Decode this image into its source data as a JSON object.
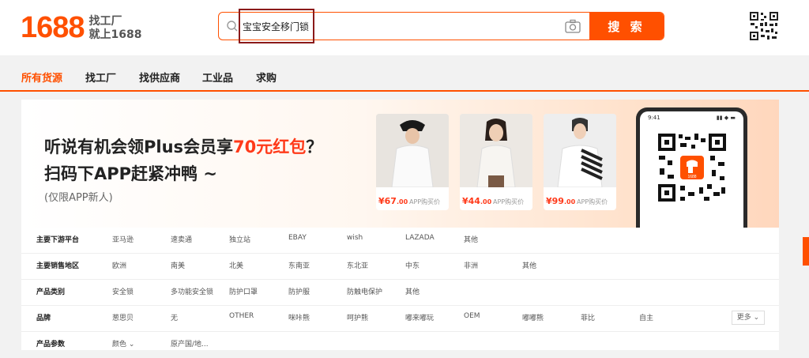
{
  "logo": {
    "number": "1688",
    "slogan_line1": "找工厂",
    "slogan_line2": "就上1688"
  },
  "search": {
    "query": "宝宝安全移门锁",
    "button_label": "搜 索"
  },
  "icons": {
    "search": "search-icon",
    "camera": "camera-icon",
    "qr": "qr-code-icon"
  },
  "colors": {
    "brand": "#ff5000",
    "price": "#ff3a1a"
  },
  "nav": {
    "items": [
      {
        "label": "所有货源",
        "active": true
      },
      {
        "label": "找工厂",
        "active": false
      },
      {
        "label": "找供应商",
        "active": false
      },
      {
        "label": "工业品",
        "active": false
      },
      {
        "label": "求购",
        "active": false
      }
    ]
  },
  "banner": {
    "line1_prefix": "听说有机会领Plus会员享",
    "line1_highlight": "70元红包",
    "line1_suffix": "？",
    "line2": "扫码下APP赶紧冲鸭 ~",
    "note": "(仅限APP新人)",
    "products": [
      {
        "currency": "¥",
        "price": "67",
        "cents": ".00",
        "tag": "APP购买价"
      },
      {
        "currency": "¥",
        "price": "44",
        "cents": ".00",
        "tag": "APP购买价"
      },
      {
        "currency": "¥",
        "price": "99",
        "cents": ".00",
        "tag": "APP购买价"
      }
    ],
    "phone": {
      "time": "9:41",
      "qr_label": "1688"
    }
  },
  "filters": [
    {
      "label": "主要下游平台",
      "options": [
        "亚马逊",
        "速卖通",
        "独立站",
        "EBAY",
        "wish",
        "LAZADA",
        "其他"
      ]
    },
    {
      "label": "主要销售地区",
      "options": [
        "欧洲",
        "南美",
        "北美",
        "东南亚",
        "东北亚",
        "中东",
        "非洲",
        "其他"
      ]
    },
    {
      "label": "产品类别",
      "options": [
        "安全锁",
        "多功能安全锁",
        "防护口罩",
        "防护服",
        "防触电保护",
        "其他"
      ]
    },
    {
      "label": "品牌",
      "options": [
        "葱思贝",
        "无",
        "OTHER",
        "咪咔熊",
        "呵护熊",
        "嘟来嘟玩",
        "OEM",
        "嘟嘟熊",
        "菲比",
        "自主"
      ],
      "more": "更多"
    },
    {
      "label": "产品参数",
      "options": [
        "颜色",
        "原产国/地..."
      ]
    }
  ]
}
